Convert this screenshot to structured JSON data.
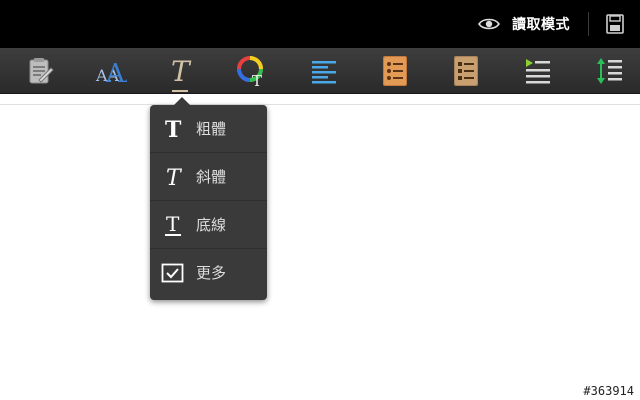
{
  "header": {
    "read_mode_label": "讀取模式",
    "read_mode_icon": "eye-icon",
    "save_icon": "save-icon"
  },
  "toolbar": {
    "tools": [
      {
        "name": "edit-document-icon"
      },
      {
        "name": "font-size-icon",
        "text": "AA"
      },
      {
        "name": "text-style-icon",
        "text": "T",
        "active": true
      },
      {
        "name": "text-color-icon",
        "text": "T"
      },
      {
        "name": "align-left-icon"
      },
      {
        "name": "bulleted-list-icon"
      },
      {
        "name": "numbered-list-icon"
      },
      {
        "name": "indent-icon"
      },
      {
        "name": "line-spacing-icon"
      }
    ]
  },
  "style_menu": {
    "items": [
      {
        "label": "粗體",
        "icon": "bold-icon",
        "glyph": "T"
      },
      {
        "label": "斜體",
        "icon": "italic-icon",
        "glyph": "T"
      },
      {
        "label": "底線",
        "icon": "underline-icon",
        "glyph": "T"
      },
      {
        "label": "更多",
        "icon": "checkbox-icon"
      }
    ]
  },
  "watermark": "#363914"
}
